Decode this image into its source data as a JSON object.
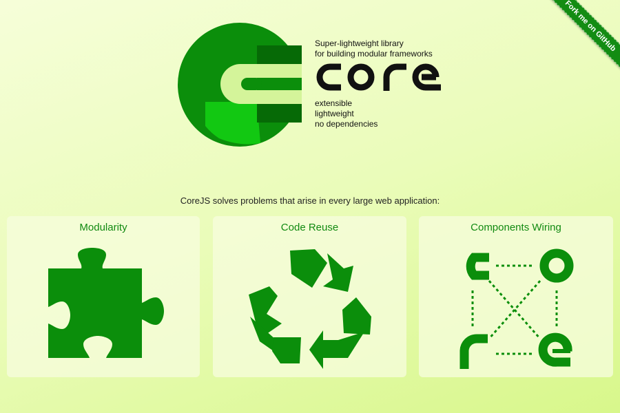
{
  "ribbon": {
    "label": "Fork me on GitHub"
  },
  "hero": {
    "tagline_line1": "Super-lightweight library",
    "tagline_line2": "for building modular frameworks",
    "wordmark": "core",
    "features": [
      "extensible",
      "lightweight",
      "no dependencies"
    ]
  },
  "intro": "CoreJS solves problems that arise in every large web application:",
  "cards": [
    {
      "title": "Modularity",
      "icon": "puzzle-piece-icon"
    },
    {
      "title": "Code Reuse",
      "icon": "recycle-icon"
    },
    {
      "title": "Components Wiring",
      "icon": "components-wiring-icon"
    }
  ],
  "colors": {
    "brand_green": "#0b8e0b",
    "dark_green": "#066a06",
    "light_green": "#12c812",
    "background_light": "#f6fed9",
    "background_dark": "#d8f78b"
  }
}
